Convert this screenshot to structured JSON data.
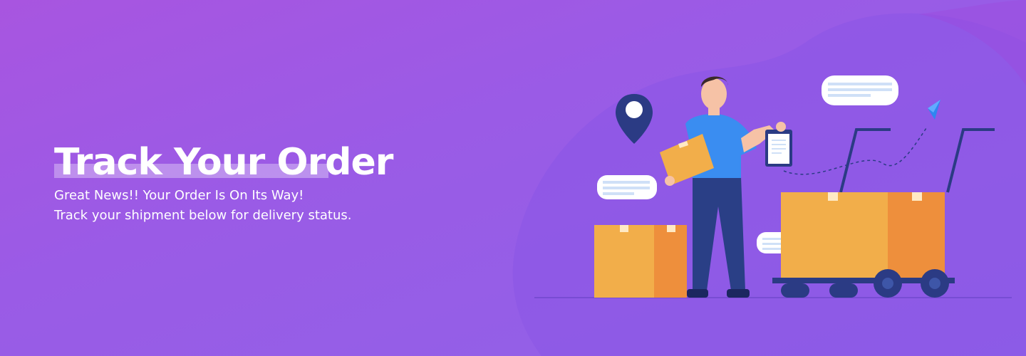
{
  "hero": {
    "title": "Track Your Order",
    "subtitle_line1": "Great News!! Your Order Is On Its Way!",
    "subtitle_line2": "Track your shipment below for delivery status."
  },
  "colors": {
    "background_start": "#a855e0",
    "background_end": "#8f62e8",
    "box_orange": "#f2ae4a",
    "box_orange_dark": "#ee8f3c",
    "shirt_blue": "#3a8df1",
    "pants_navy": "#2a3f86",
    "pin_navy": "#2b3b84"
  },
  "icons": {
    "location": "location-pin-icon",
    "paper_plane": "paper-plane-icon",
    "clipboard": "clipboard-icon"
  }
}
